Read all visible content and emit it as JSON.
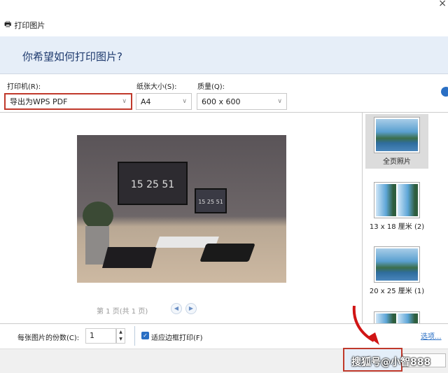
{
  "window": {
    "title": "打印图片",
    "close": "×"
  },
  "header": {
    "question": "你希望如何打印图片?"
  },
  "controls": {
    "printer": {
      "label": "打印机(R):",
      "value": "导出为WPS PDF"
    },
    "paper": {
      "label": "纸张大小(S):",
      "value": "A4"
    },
    "quality": {
      "label": "质量(Q):",
      "value": "600 x 600"
    }
  },
  "preview": {
    "clock_main": "15 25 51",
    "clock_small": "15 25 51",
    "pager": "第 1 页(共 1 页)"
  },
  "layouts": [
    {
      "label": "全页照片",
      "selected": true
    },
    {
      "label": "13 x 18 厘米 (2)"
    },
    {
      "label": "20 x 25 厘米 (1)"
    }
  ],
  "bottom": {
    "copies_label": "每张图片的份数(C):",
    "copies_value": "1",
    "fit_label": "适应边框打印(F)",
    "fit_checked": true,
    "options_link": "选项..."
  },
  "watermark": "搜狐号@小智888",
  "colors": {
    "accent": "#2a6fc4",
    "highlight": "#c0392b",
    "band": "#e6eef8"
  }
}
